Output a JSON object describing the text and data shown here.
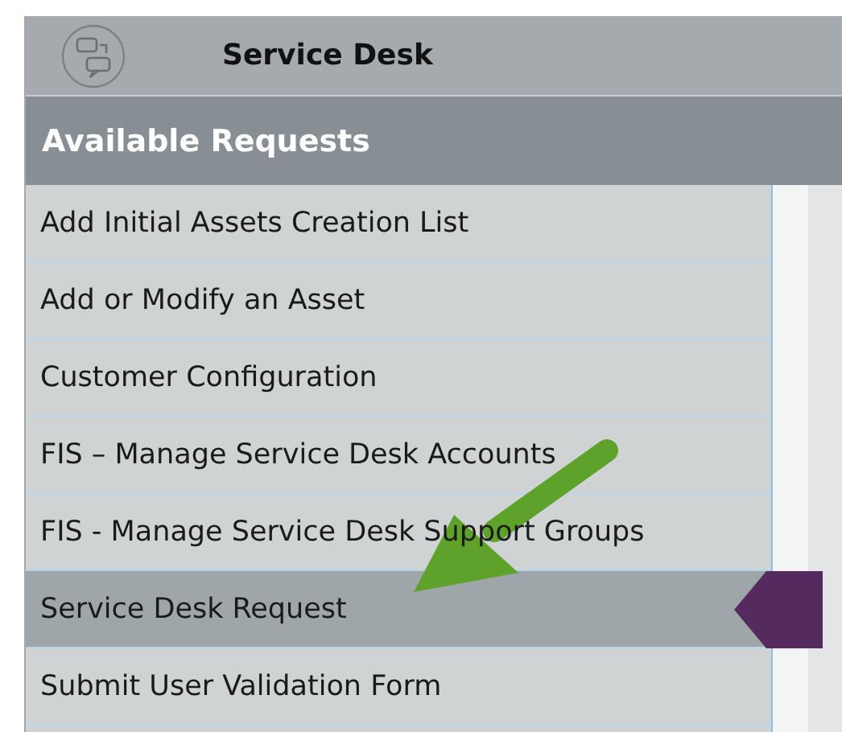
{
  "header": {
    "title": "Service Desk"
  },
  "section": {
    "title": "Available Requests"
  },
  "requests": [
    {
      "label": "Add Initial Assets Creation List",
      "selected": false
    },
    {
      "label": "Add or Modify an Asset",
      "selected": false
    },
    {
      "label": "Customer Configuration",
      "selected": false
    },
    {
      "label": "FIS – Manage Service Desk Accounts",
      "selected": false
    },
    {
      "label": "FIS - Manage Service Desk Support Groups",
      "selected": false
    },
    {
      "label": "Service Desk Request",
      "selected": true
    },
    {
      "label": "Submit User Validation Form",
      "selected": false
    }
  ]
}
